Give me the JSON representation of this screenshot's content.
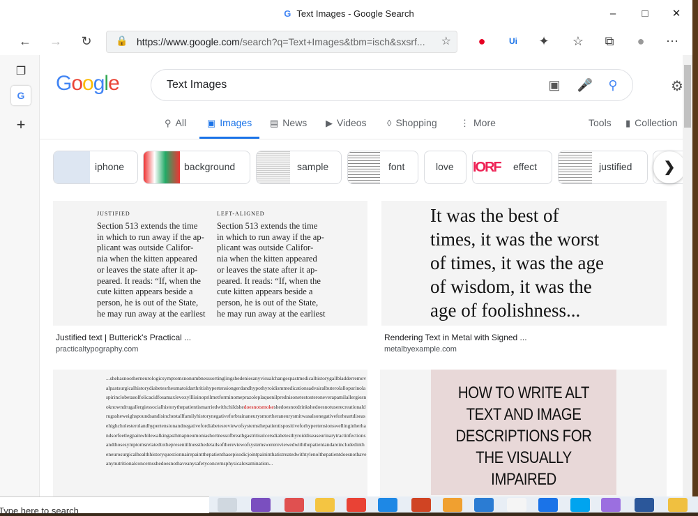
{
  "window": {
    "title": "Text Images - Google Search",
    "favicon": "G"
  },
  "toolbar": {
    "url_host": "https://www.google.com",
    "url_rest": "/search?q=Text+Images&tbm=isch&sxsrf...",
    "icons": [
      "back-icon",
      "forward-icon",
      "refresh-icon",
      "lock-icon",
      "add-favorite-icon",
      "pinterest-icon",
      "uipath-icon",
      "extensions-icon",
      "favorites-icon",
      "collections-icon",
      "profile-icon",
      "more-icon"
    ]
  },
  "search": {
    "query": "Text Images"
  },
  "logo": {
    "letters": [
      "G",
      "o",
      "o",
      "g",
      "l",
      "e"
    ]
  },
  "tabs": [
    {
      "label": "All",
      "icon": "search-icon"
    },
    {
      "label": "Images",
      "icon": "image-icon"
    },
    {
      "label": "News",
      "icon": "news-icon"
    },
    {
      "label": "Videos",
      "icon": "video-icon"
    },
    {
      "label": "Shopping",
      "icon": "tag-icon"
    },
    {
      "label": "More",
      "icon": "kebab-icon"
    }
  ],
  "tools": {
    "tools_label": "Tools",
    "collections_label": "Collection"
  },
  "chips": [
    "iphone",
    "background",
    "sample",
    "font",
    "love",
    "effect",
    "justified"
  ],
  "chip_love_thumb": "IORF",
  "results": [
    {
      "caption": "Justified text | Butterick's Practical ...",
      "source": "practicaltypography.com",
      "col1_head": "JUSTIFIED",
      "col2_head": "LEFT-ALIGNED",
      "col1_lines": [
        "Section 513 extends the time",
        "in which to run away if the ap-",
        "plicant was outside Califor-",
        "nia when the kitten appeared",
        "or leaves the state after it ap-",
        "peared. It reads: “If, when the",
        "cute kitten appears beside a",
        "person, he is out of the State,",
        "he may run away at the earliest"
      ],
      "col2_lines": [
        "Section 513 extends the time",
        "in which to run away if the ap-",
        "plicant was outside Califor-",
        "nia when the kitten appeared",
        "or leaves the state after it ap-",
        "peared. It reads: “If, when the",
        "cute kitten appears beside a",
        "person, he is out of the State,",
        "he may run away at the earliest"
      ]
    },
    {
      "caption": "Rendering Text in Metal with Signed ...",
      "source": "metalbyexample.com",
      "lines": [
        "It was the best of",
        "times, it was the worst",
        "of times, it was the age",
        "of wisdom, it was the",
        "age of foolishness..."
      ]
    },
    {
      "dense_before": "...shehasnootherneurologicsymptomsnonumbnesssortinglingshedeniesanyvisualchangespastmedicalhistorygallbladderremovalpastsurgicalhistorydiabetesrheumatoidarthritishypertensiongerdandhypothyroidismmedicationsadvairalbuterolallopurinolaspirinclobetasolfolicacidfosamaxlevoxylllisinoprilmetforminomeprazoleplaquenilprednisonetestosteroneverapamilallergiesnoknowndrugallergiessocialhistorythepatientismarriedwithchildshe",
      "dense_red": "doesnotsmoke",
      "dense_after": "shedoesnotdrinkshedoesnotuserecreationaldrugssheweighspoundsandisinchestallfamilyhistorynegativeforbrainaneurysmortheraneurysmitwasalsonegativeforheartdiseasehighcholesterolandhypertensionandnegativefordiabetesreviewofsystemsthepatientispositiveforhypertensionswellinginherhandsorfeetlegpainwhilewalkingasthmapneumoniashortnessofbreathgastritisulcersdiabetesthyroiddiseaseurinarytractinfectionsandthosesymptomsrelatedtothepresentillnessthedetailsofthereviewofsystemswerereviewedwiththepatientandareincludedintheneurosurgicalhealthhistoryquestionnairepaintthepatienthasepisodicjointpaininthatistreatedwithtylenolthepatientdoesnothaveanynutritionalconcernsshedoesnothaveanysafetyconcernsphysicalexamination..."
    },
    {
      "lines": [
        "HOW TO WRITE ALT",
        "TEXT AND IMAGE",
        "DESCRIPTIONS FOR",
        "THE VISUALLY",
        "IMPAIRED"
      ]
    }
  ],
  "taskbar": {
    "search_placeholder": "Type here to search"
  },
  "colors": {
    "accent": "#1a73e8",
    "google_blue": "#4285f4",
    "google_red": "#ea4335",
    "google_yellow": "#fbbc05",
    "google_green": "#34a853"
  }
}
